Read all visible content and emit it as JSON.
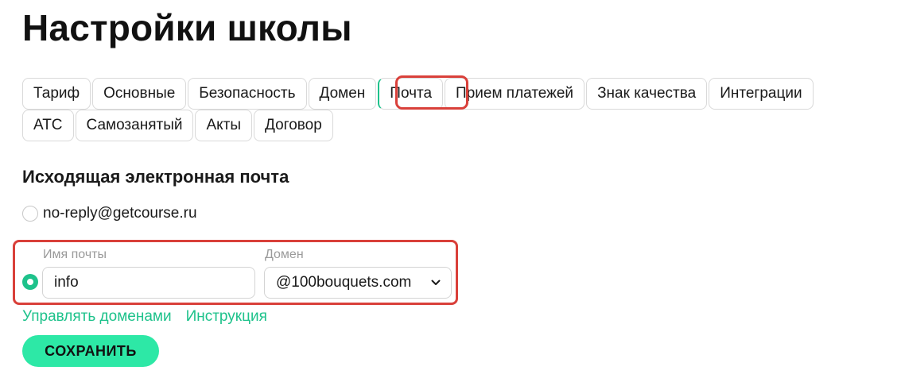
{
  "page": {
    "title": "Настройки школы"
  },
  "tabs": {
    "row1": [
      {
        "label": "Тариф",
        "active": false
      },
      {
        "label": "Основные",
        "active": false
      },
      {
        "label": "Безопасность",
        "active": false
      },
      {
        "label": "Домен",
        "active": false
      },
      {
        "label": "Почта",
        "active": true
      },
      {
        "label": "Прием платежей",
        "active": false
      },
      {
        "label": "Знак качества",
        "active": false
      },
      {
        "label": "Интеграции",
        "active": false
      }
    ],
    "row2": [
      {
        "label": "АТС",
        "active": false
      },
      {
        "label": "Самозанятый",
        "active": false
      },
      {
        "label": "Акты",
        "active": false
      },
      {
        "label": "Договор",
        "active": false
      }
    ]
  },
  "outgoing_mail": {
    "section_title": "Исходящая электронная почта",
    "default_option": {
      "label": "no-reply@getcourse.ru",
      "selected": false
    },
    "custom_option": {
      "selected": true,
      "name_label": "Имя почты",
      "name_value": "info",
      "domain_label": "Домен",
      "domain_value": "@100bouquets.com"
    },
    "links": {
      "manage_domains": "Управлять доменами",
      "instruction": "Инструкция"
    },
    "save_label": "СОХРАНИТЬ"
  },
  "icons": {
    "domain_dropdown": "chevron-down-icon"
  },
  "colors": {
    "accent": "#1ec28b",
    "button": "#2de8a6",
    "highlight": "#d9403a"
  }
}
